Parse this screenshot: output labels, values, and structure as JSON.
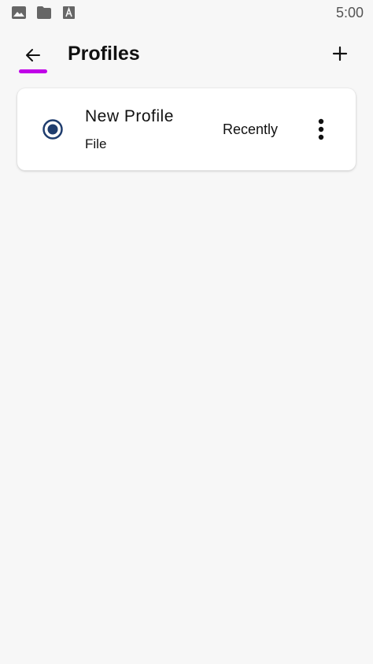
{
  "status_bar": {
    "time": "5:00",
    "icons": [
      "image-icon",
      "folder-icon",
      "font-icon"
    ]
  },
  "app_bar": {
    "title": "Profiles",
    "back_icon": "arrow-left-icon",
    "add_icon": "plus-icon",
    "accent_color": "#c000e8"
  },
  "profiles": [
    {
      "name": "New Profile",
      "type": "File",
      "updated": "Recently",
      "selected": true,
      "radio_color": "#1f3d6e"
    }
  ]
}
